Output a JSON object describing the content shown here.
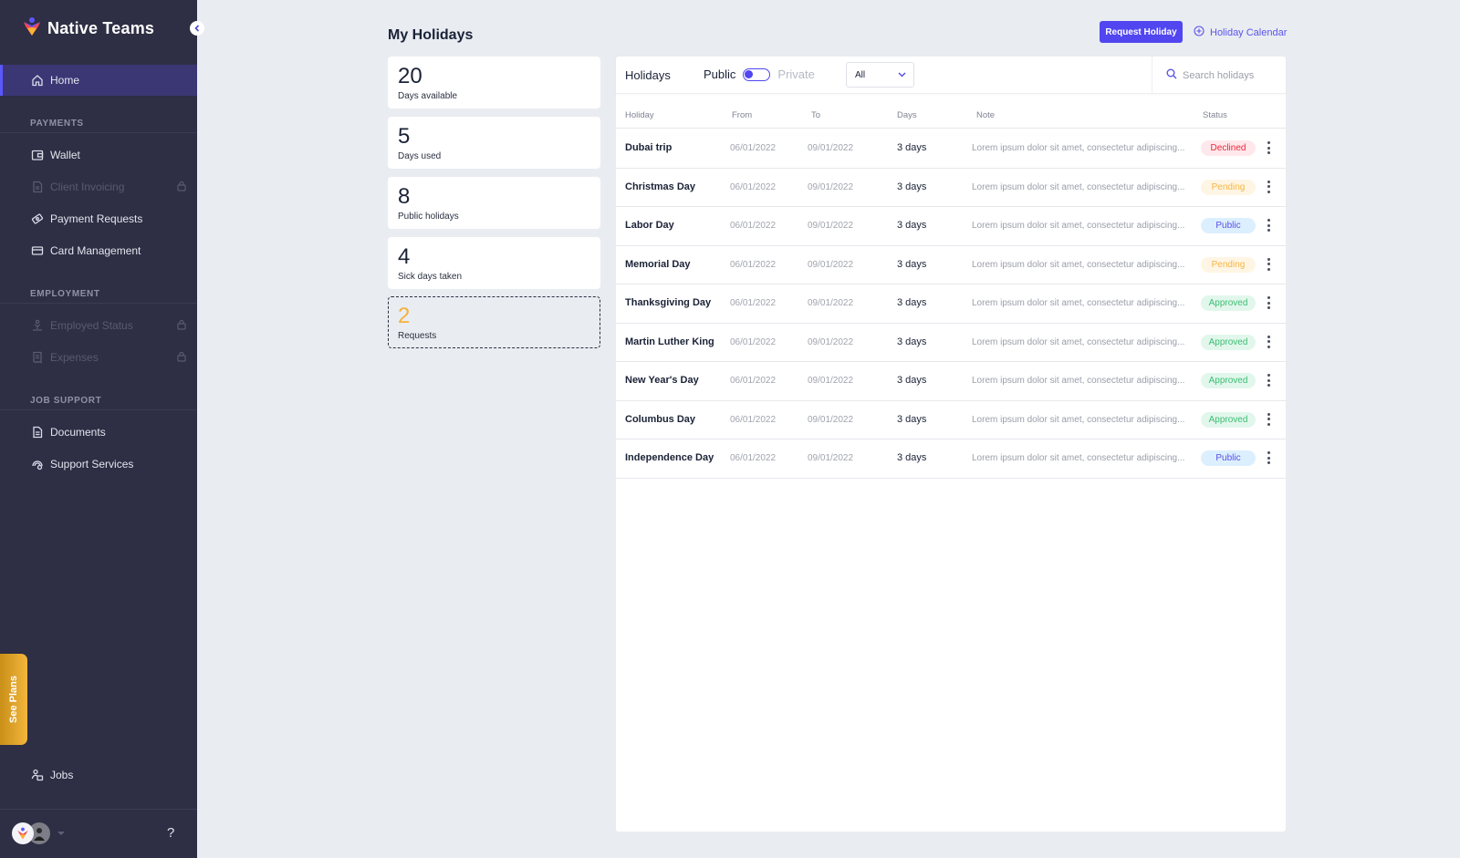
{
  "app": {
    "name": "Native Teams",
    "brand_color": "#5146f0"
  },
  "sidebar": {
    "home": {
      "label": "Home",
      "icon": "home-icon",
      "active": true
    },
    "sections": [
      {
        "title": "PAYMENTS",
        "items": [
          {
            "label": "Wallet",
            "icon": "wallet-icon",
            "locked": false
          },
          {
            "label": "Client Invoicing",
            "icon": "invoice-icon",
            "locked": true
          },
          {
            "label": "Payment Requests",
            "icon": "payment-request-icon",
            "locked": false
          },
          {
            "label": "Card Management",
            "icon": "card-icon",
            "locked": false
          }
        ]
      },
      {
        "title": "EMPLOYMENT",
        "items": [
          {
            "label": "Employed Status",
            "icon": "employed-status-icon",
            "locked": true
          },
          {
            "label": "Expenses",
            "icon": "receipt-icon",
            "locked": true
          }
        ]
      },
      {
        "title": "JOB SUPPORT",
        "items": [
          {
            "label": "Documents",
            "icon": "document-icon",
            "locked": false
          },
          {
            "label": "Support Services",
            "icon": "support-icon",
            "locked": false
          }
        ]
      }
    ],
    "see_plans": "See Plans",
    "jobs": {
      "label": "Jobs",
      "icon": "jobs-icon"
    },
    "help": "?"
  },
  "page": {
    "title": "My Holidays",
    "request_button": "Request Holiday",
    "calendar_link": "Holiday Calendar"
  },
  "stats": [
    {
      "value": "20",
      "label": "Days available"
    },
    {
      "value": "5",
      "label": "Days used"
    },
    {
      "value": "8",
      "label": "Public holidays"
    },
    {
      "value": "4",
      "label": "Sick days taken"
    },
    {
      "value": "2",
      "label": "Requests",
      "highlight": true
    }
  ],
  "panel": {
    "title": "Holidays",
    "toggle_on": "Public",
    "toggle_off": "Private",
    "filter_value": "All",
    "search_placeholder": "Search holidays"
  },
  "table": {
    "columns": [
      "Holiday",
      "From",
      "To",
      "Days",
      "Note",
      "Status"
    ],
    "rows": [
      {
        "holiday": "Dubai trip",
        "from": "06/01/2022",
        "to": "09/01/2022",
        "days": "3 days",
        "note": "Lorem ipsum dolor sit amet, consectetur adipiscing...",
        "status": "Declined"
      },
      {
        "holiday": "Christmas Day",
        "from": "06/01/2022",
        "to": "09/01/2022",
        "days": "3 days",
        "note": "Lorem ipsum dolor sit amet, consectetur adipiscing...",
        "status": "Pending"
      },
      {
        "holiday": "Labor Day",
        "from": "06/01/2022",
        "to": "09/01/2022",
        "days": "3 days",
        "note": "Lorem ipsum dolor sit amet, consectetur adipiscing...",
        "status": "Public"
      },
      {
        "holiday": "Memorial Day",
        "from": "06/01/2022",
        "to": "09/01/2022",
        "days": "3 days",
        "note": "Lorem ipsum dolor sit amet, consectetur adipiscing...",
        "status": "Pending"
      },
      {
        "holiday": "Thanksgiving Day",
        "from": "06/01/2022",
        "to": "09/01/2022",
        "days": "3 days",
        "note": "Lorem ipsum dolor sit amet, consectetur adipiscing...",
        "status": "Approved"
      },
      {
        "holiday": "Martin Luther King",
        "from": "06/01/2022",
        "to": "09/01/2022",
        "days": "3 days",
        "note": "Lorem ipsum dolor sit amet, consectetur adipiscing...",
        "status": "Approved"
      },
      {
        "holiday": "New Year's Day",
        "from": "06/01/2022",
        "to": "09/01/2022",
        "days": "3 days",
        "note": "Lorem ipsum dolor sit amet, consectetur adipiscing...",
        "status": "Approved"
      },
      {
        "holiday": "Columbus Day",
        "from": "06/01/2022",
        "to": "09/01/2022",
        "days": "3 days",
        "note": "Lorem ipsum dolor sit amet, consectetur adipiscing...",
        "status": "Approved"
      },
      {
        "holiday": "Independence Day",
        "from": "06/01/2022",
        "to": "09/01/2022",
        "days": "3 days",
        "note": "Lorem ipsum dolor sit amet, consectetur adipiscing...",
        "status": "Public"
      }
    ]
  },
  "status_colors": {
    "Declined": "#f0243d",
    "Pending": "#f6b545",
    "Public": "#5b4ee6",
    "Approved": "#3bbd72"
  }
}
